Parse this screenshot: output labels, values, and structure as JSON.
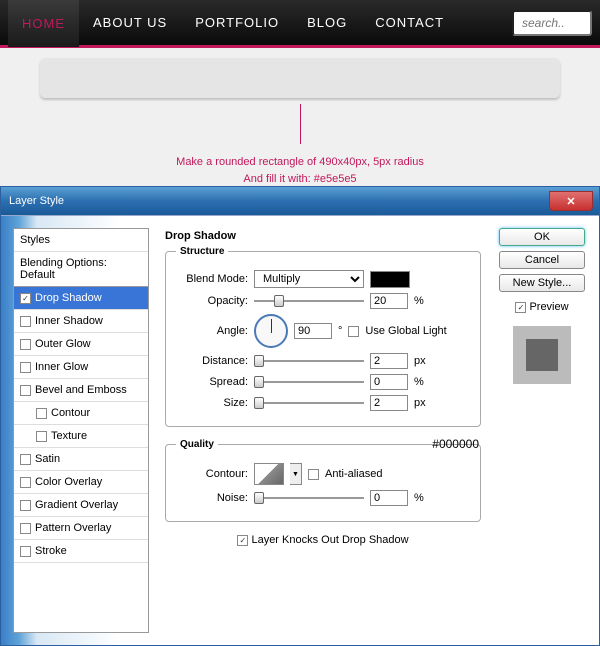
{
  "nav": {
    "items": [
      "HOME",
      "ABOUT US",
      "PORTFOLIO",
      "BLOG",
      "CONTACT"
    ],
    "active": 0,
    "search_placeholder": "search.."
  },
  "annotation": {
    "line1": "Make a rounded rectangle of 490x40px, 5px radius",
    "line2": "And fill it with: #e5e5e5"
  },
  "dialog": {
    "title": "Layer Style",
    "styles_header": "Styles",
    "blending": "Blending Options: Default",
    "effects": [
      {
        "label": "Drop Shadow",
        "checked": true,
        "active": true
      },
      {
        "label": "Inner Shadow",
        "checked": false
      },
      {
        "label": "Outer Glow",
        "checked": false
      },
      {
        "label": "Inner Glow",
        "checked": false
      },
      {
        "label": "Bevel and Emboss",
        "checked": false
      },
      {
        "label": "Contour",
        "checked": false,
        "indent": true
      },
      {
        "label": "Texture",
        "checked": false,
        "indent": true
      },
      {
        "label": "Satin",
        "checked": false
      },
      {
        "label": "Color Overlay",
        "checked": false
      },
      {
        "label": "Gradient Overlay",
        "checked": false
      },
      {
        "label": "Pattern Overlay",
        "checked": false
      },
      {
        "label": "Stroke",
        "checked": false
      }
    ],
    "panel_title": "Drop Shadow",
    "structure": {
      "legend": "Structure",
      "blend_mode_label": "Blend Mode:",
      "blend_mode_value": "Multiply",
      "color_hex": "#000000",
      "opacity_label": "Opacity:",
      "opacity_value": "20",
      "opacity_unit": "%",
      "angle_label": "Angle:",
      "angle_value": "90",
      "angle_unit": "°",
      "global_light_label": "Use Global Light",
      "distance_label": "Distance:",
      "distance_value": "2",
      "distance_unit": "px",
      "spread_label": "Spread:",
      "spread_value": "0",
      "spread_unit": "%",
      "size_label": "Size:",
      "size_value": "2",
      "size_unit": "px"
    },
    "quality": {
      "legend": "Quality",
      "contour_label": "Contour:",
      "anti_label": "Anti-aliased",
      "noise_label": "Noise:",
      "noise_value": "0",
      "noise_unit": "%"
    },
    "knockout_label": "Layer Knocks Out Drop Shadow",
    "buttons": {
      "ok": "OK",
      "cancel": "Cancel",
      "new_style": "New Style...",
      "preview": "Preview"
    }
  }
}
